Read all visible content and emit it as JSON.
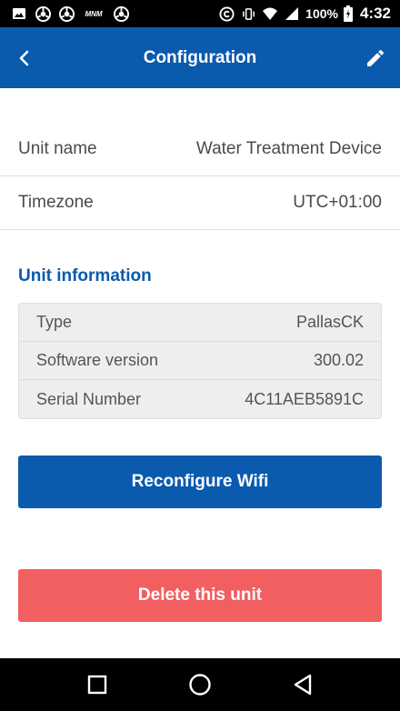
{
  "status_bar": {
    "battery": "100%",
    "time": "4:32",
    "icons": [
      "image-icon",
      "chrome-icon",
      "chrome-icon",
      "mnm-app-icon",
      "chrome-icon",
      "circle-c-icon",
      "vibrate-icon",
      "wifi-icon",
      "signal-icon",
      "battery-charging-icon"
    ],
    "small_app_label": "MNM"
  },
  "header": {
    "title": "Configuration",
    "back_icon": "chevron-left-icon",
    "edit_icon": "pencil-icon"
  },
  "settings": [
    {
      "label": "Unit name",
      "value": "Water Treatment Device"
    },
    {
      "label": "Timezone",
      "value": "UTC+01:00"
    }
  ],
  "unit_info": {
    "title": "Unit information",
    "rows": [
      {
        "label": "Type",
        "value": "PallasCK"
      },
      {
        "label": "Software version",
        "value": "300.02"
      },
      {
        "label": "Serial Number",
        "value": "4C11AEB5891C"
      }
    ]
  },
  "actions": {
    "reconfigure_label": "Reconfigure Wifi",
    "delete_label": "Delete this unit"
  },
  "nav_bar": {
    "icons": [
      "recents-square-icon",
      "home-circle-icon",
      "back-triangle-icon"
    ]
  },
  "colors": {
    "primary": "#0a5aad",
    "danger": "#f25f61"
  }
}
